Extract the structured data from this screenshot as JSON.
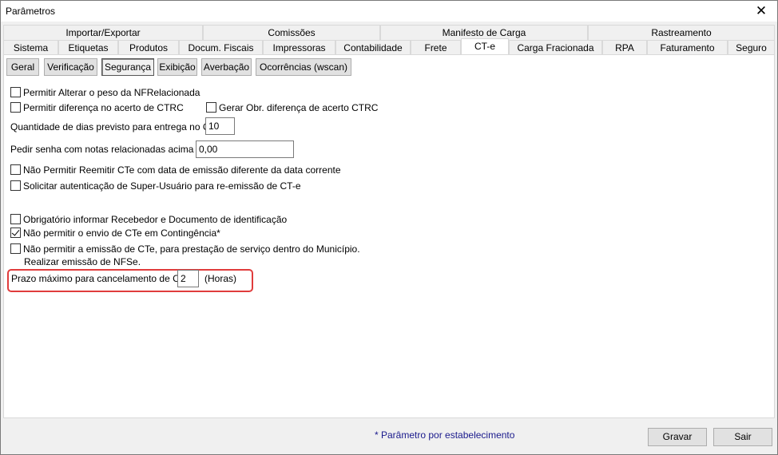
{
  "window": {
    "title": "Parâmetros",
    "close_glyph": "✕"
  },
  "tabs_top": [
    {
      "label": "Importar/Exportar"
    },
    {
      "label": "Comissões"
    },
    {
      "label": "Manifesto de Carga"
    },
    {
      "label": "Rastreamento"
    }
  ],
  "tabs_main": [
    {
      "label": "Sistema"
    },
    {
      "label": "Etiquetas"
    },
    {
      "label": "Produtos"
    },
    {
      "label": "Docum. Fiscais"
    },
    {
      "label": "Impressoras"
    },
    {
      "label": "Contabilidade"
    },
    {
      "label": "Frete"
    },
    {
      "label": "CT-e",
      "active": true
    },
    {
      "label": "Carga Fracionada"
    },
    {
      "label": "RPA"
    },
    {
      "label": "Faturamento"
    },
    {
      "label": "Seguro"
    }
  ],
  "subtabs": [
    {
      "label": "Geral"
    },
    {
      "label": "Verificação"
    },
    {
      "label": "Segurança",
      "active": true
    },
    {
      "label": "Exibição"
    },
    {
      "label": "Averbação"
    },
    {
      "label": "Ocorrências (wscan)"
    }
  ],
  "options": {
    "permitir_alterar_peso": {
      "label": "Permitir Alterar o peso da NFRelacionada",
      "checked": false
    },
    "permitir_diferenca": {
      "label": "Permitir diferença no acerto de CTRC",
      "checked": false
    },
    "gerar_obr_diferenca": {
      "label": "Gerar Obr. diferença de acerto CTRC",
      "checked": false
    },
    "dias_previsto": {
      "label": "Quantidade de dias previsto para entrega no CTe",
      "value": "10"
    },
    "pedir_senha": {
      "label": "Pedir senha com notas relacionadas acima de",
      "value": "0,00"
    },
    "nao_permitir_reemitir": {
      "label": "Não Permitir Reemitir CTe com data de emissão diferente da data corrente",
      "checked": false
    },
    "solicitar_autenticacao": {
      "label": "Solicitar autenticação de Super-Usuário para re-emissão de CT-e",
      "checked": false
    },
    "obrigatorio_recebedor": {
      "label": "Obrigatório informar Recebedor e Documento de identificação",
      "checked": false
    },
    "nao_permitir_contingencia": {
      "label": "Não permitir o envio de CTe em Contingência*",
      "checked": true
    },
    "nao_permitir_municipio": {
      "label": "Não permitir a emissão de CTe, para prestação de serviço dentro do Município.",
      "label2": "Realizar emissão de NFSe.",
      "checked": false
    },
    "prazo_cancelamento": {
      "label": "Prazo máximo para cancelamento de CTe",
      "value": "2",
      "unit": "(Horas)"
    }
  },
  "footer": {
    "note": "* Parâmetro por estabelecimento",
    "save_label": "Gravar",
    "exit_label": "Sair"
  },
  "colors": {
    "highlight": "#e03c3c",
    "note_text": "#1a1a8c"
  }
}
